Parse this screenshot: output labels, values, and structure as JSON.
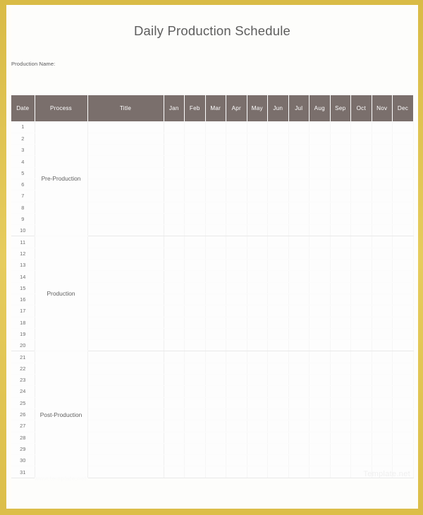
{
  "document": {
    "title": "Daily Production Schedule",
    "production_name_label": "Production Name:"
  },
  "theme": {
    "frame_color": "#dcbe49",
    "page_color": "#fdfdfb",
    "header_row_color": "#7a6f6c",
    "header_text_color": "#ffffff",
    "body_text_color": "#6d6d6d"
  },
  "table": {
    "columns": [
      {
        "key": "date",
        "label": "Date"
      },
      {
        "key": "process",
        "label": "Process"
      },
      {
        "key": "title",
        "label": "Title"
      },
      {
        "key": "jan",
        "label": "Jan"
      },
      {
        "key": "feb",
        "label": "Feb"
      },
      {
        "key": "mar",
        "label": "Mar"
      },
      {
        "key": "apr",
        "label": "Apr"
      },
      {
        "key": "may",
        "label": "May"
      },
      {
        "key": "jun",
        "label": "Jun"
      },
      {
        "key": "jul",
        "label": "Jul"
      },
      {
        "key": "aug",
        "label": "Aug"
      },
      {
        "key": "sep",
        "label": "Sep"
      },
      {
        "key": "oct",
        "label": "Oct"
      },
      {
        "key": "nov",
        "label": "Nov"
      },
      {
        "key": "dec",
        "label": "Dec"
      }
    ],
    "month_columns": [
      "Jan",
      "Feb",
      "Mar",
      "Apr",
      "May",
      "Jun",
      "Jul",
      "Aug",
      "Sep",
      "Oct",
      "Nov",
      "Dec"
    ],
    "dates": [
      "1",
      "2",
      "3",
      "4",
      "5",
      "6",
      "7",
      "8",
      "9",
      "10",
      "11",
      "12",
      "13",
      "14",
      "15",
      "16",
      "17",
      "18",
      "19",
      "20",
      "21",
      "22",
      "23",
      "24",
      "25",
      "26",
      "27",
      "28",
      "29",
      "30",
      "31"
    ],
    "groups": [
      {
        "label": "Pre-Production",
        "start_date": "1",
        "end_date": "10",
        "row_count": 10,
        "label_row_index": 5
      },
      {
        "label": "Production",
        "start_date": "11",
        "end_date": "20",
        "row_count": 10,
        "label_row_index": 5
      },
      {
        "label": "Post-Production",
        "start_date": "21",
        "end_date": "31",
        "row_count": 11,
        "label_row_index": 5
      }
    ],
    "title_values": [],
    "cell_values": []
  },
  "watermarks": {
    "brand": "Template.net",
    "url": "www.template.net"
  }
}
